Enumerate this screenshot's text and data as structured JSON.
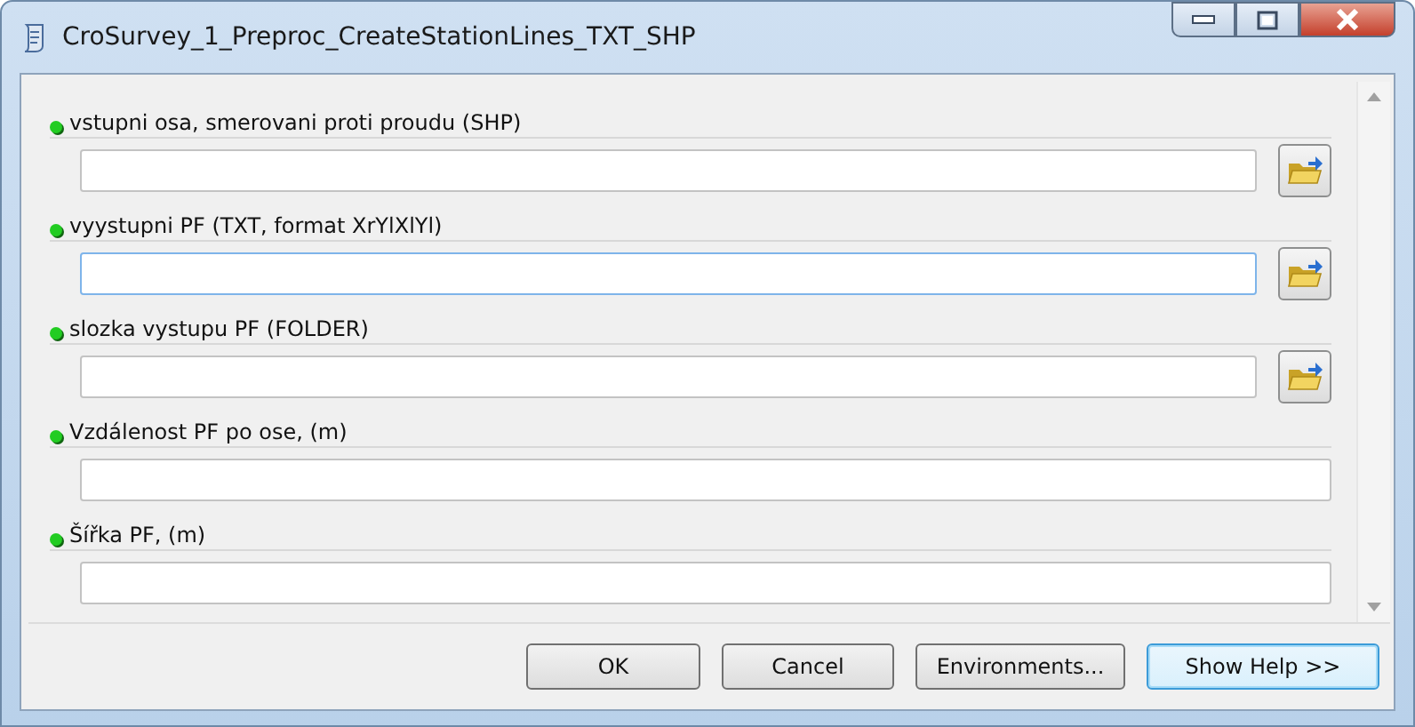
{
  "window": {
    "title": "CroSurvey_1_Preproc_CreateStationLines_TXT_SHP"
  },
  "parameters": [
    {
      "label": "vstupni osa, smerovani proti proudu (SHP)",
      "kind": "file",
      "focused": false
    },
    {
      "label": "vyystupni PF (TXT, format XrYlXlYl)",
      "kind": "file",
      "focused": true
    },
    {
      "label": "slozka vystupu PF (FOLDER)",
      "kind": "file",
      "focused": false
    },
    {
      "label": "Vzdálenost PF po ose, (m)",
      "kind": "text",
      "focused": false
    },
    {
      "label": "Šířka PF, (m)",
      "kind": "text",
      "focused": false
    }
  ],
  "buttons": [
    {
      "label": "OK",
      "focused": false
    },
    {
      "label": "Cancel",
      "focused": false
    },
    {
      "label": "Environments...",
      "focused": false
    },
    {
      "label": "Show Help >>",
      "focused": true
    }
  ]
}
